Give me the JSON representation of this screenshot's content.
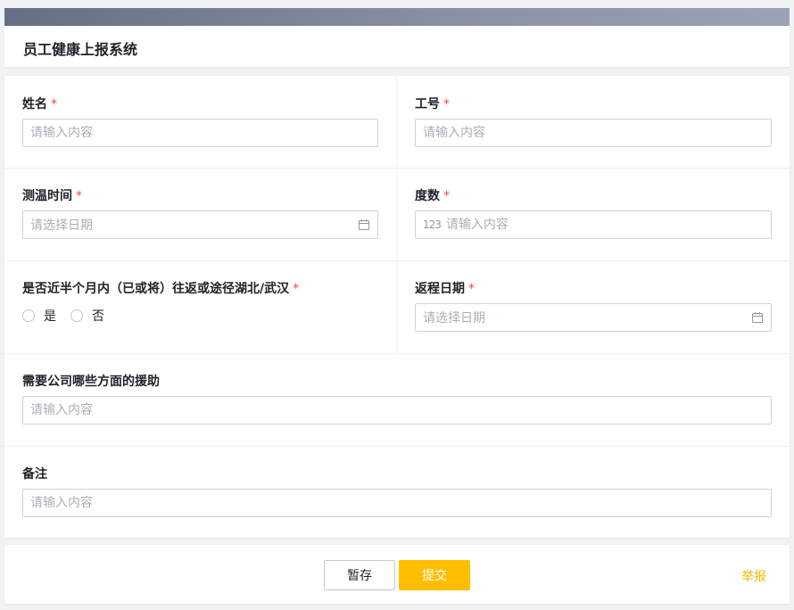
{
  "app": {
    "title": "员工健康上报系统"
  },
  "form": {
    "name": {
      "label": "姓名",
      "required_mark": "*",
      "placeholder": "请输入内容",
      "value": ""
    },
    "employee_id": {
      "label": "工号",
      "required_mark": "*",
      "placeholder": "请输入内容",
      "value": ""
    },
    "measure_time": {
      "label": "测温时间",
      "required_mark": "*",
      "placeholder": "请选择日期",
      "icon": "calendar-icon"
    },
    "temperature": {
      "label": "度数",
      "required_mark": "*",
      "placeholder": "请输入内容",
      "prefix_icon_text": "123",
      "icon": "number-icon"
    },
    "travel_question": {
      "label": "是否近半个月内（已或将）往返或途径湖北/武汉",
      "required_mark": "*",
      "options": [
        "是",
        "否"
      ]
    },
    "return_date": {
      "label": "返程日期",
      "required_mark": "*",
      "placeholder": "请选择日期",
      "icon": "calendar-icon"
    },
    "assistance": {
      "label": "需要公司哪些方面的援助",
      "placeholder": "请输入内容",
      "value": ""
    },
    "notes": {
      "label": "备注",
      "placeholder": "请输入内容",
      "value": ""
    }
  },
  "actions": {
    "save_label": "暂存",
    "submit_label": "提交",
    "report_label": "举报"
  },
  "colors": {
    "primary": "#ffbf00",
    "required": "#f54a45",
    "link": "#f5b800"
  }
}
